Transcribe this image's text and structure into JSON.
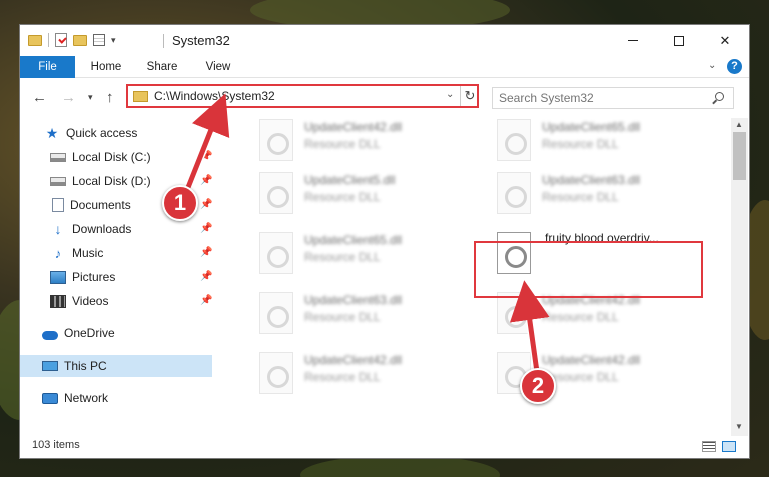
{
  "window": {
    "title": "System32",
    "controls": {
      "minimize": "—",
      "maximize": "☐",
      "close": "✕"
    }
  },
  "ribbon": {
    "tabs": [
      "File",
      "Home",
      "Share",
      "View"
    ]
  },
  "navigation": {
    "address": "C:\\Windows\\System32",
    "search_placeholder": "Search System32"
  },
  "sidebar": {
    "items": [
      {
        "label": "Quick access",
        "icon": "star-icon"
      },
      {
        "label": "Local Disk (C:)",
        "icon": "disk-icon",
        "pinned": true
      },
      {
        "label": "Local Disk (D:)",
        "icon": "disk-icon",
        "pinned": true
      },
      {
        "label": "Documents",
        "icon": "documents-icon",
        "pinned": true
      },
      {
        "label": "Downloads",
        "icon": "downloads-icon",
        "pinned": true
      },
      {
        "label": "Music",
        "icon": "music-icon",
        "pinned": true
      },
      {
        "label": "Pictures",
        "icon": "pictures-icon",
        "pinned": true
      },
      {
        "label": "Videos",
        "icon": "videos-icon",
        "pinned": true
      },
      {
        "label": "OneDrive",
        "icon": "onedrive-icon"
      },
      {
        "label": "This PC",
        "icon": "this-pc-icon",
        "selected": true
      },
      {
        "label": "Network",
        "icon": "network-icon"
      }
    ]
  },
  "files": [
    {
      "name": "UpdateClient42.dll",
      "type": "Resource DLL"
    },
    {
      "name": "UpdateClient65.dll",
      "type": "Resource DLL"
    },
    {
      "name": "UpdateClient5.dll",
      "type": "Resource DLL"
    },
    {
      "name": "UpdateClient63.dll",
      "type": "Resource DLL"
    },
    {
      "name": "UpdateClient65.dll",
      "type": "Resource DLL"
    },
    {
      "name": "fruity blood overdriv...",
      "type": ""
    },
    {
      "name": "UpdateClient63.dll",
      "type": "Resource DLL"
    },
    {
      "name": "UpdateClient42.dll",
      "type": "Resource DLL"
    },
    {
      "name": "UpdateClient42.dll",
      "type": "Resource DLL"
    },
    {
      "name": "UpdateClient42.dll",
      "type": "Resource DLL"
    }
  ],
  "status": {
    "item_count": "103 items"
  },
  "annotations": {
    "callout_1": "1",
    "callout_2": "2",
    "highlight_color": "#e0383e"
  },
  "colors": {
    "accent": "#1979ca",
    "selection": "#cce4f7"
  }
}
